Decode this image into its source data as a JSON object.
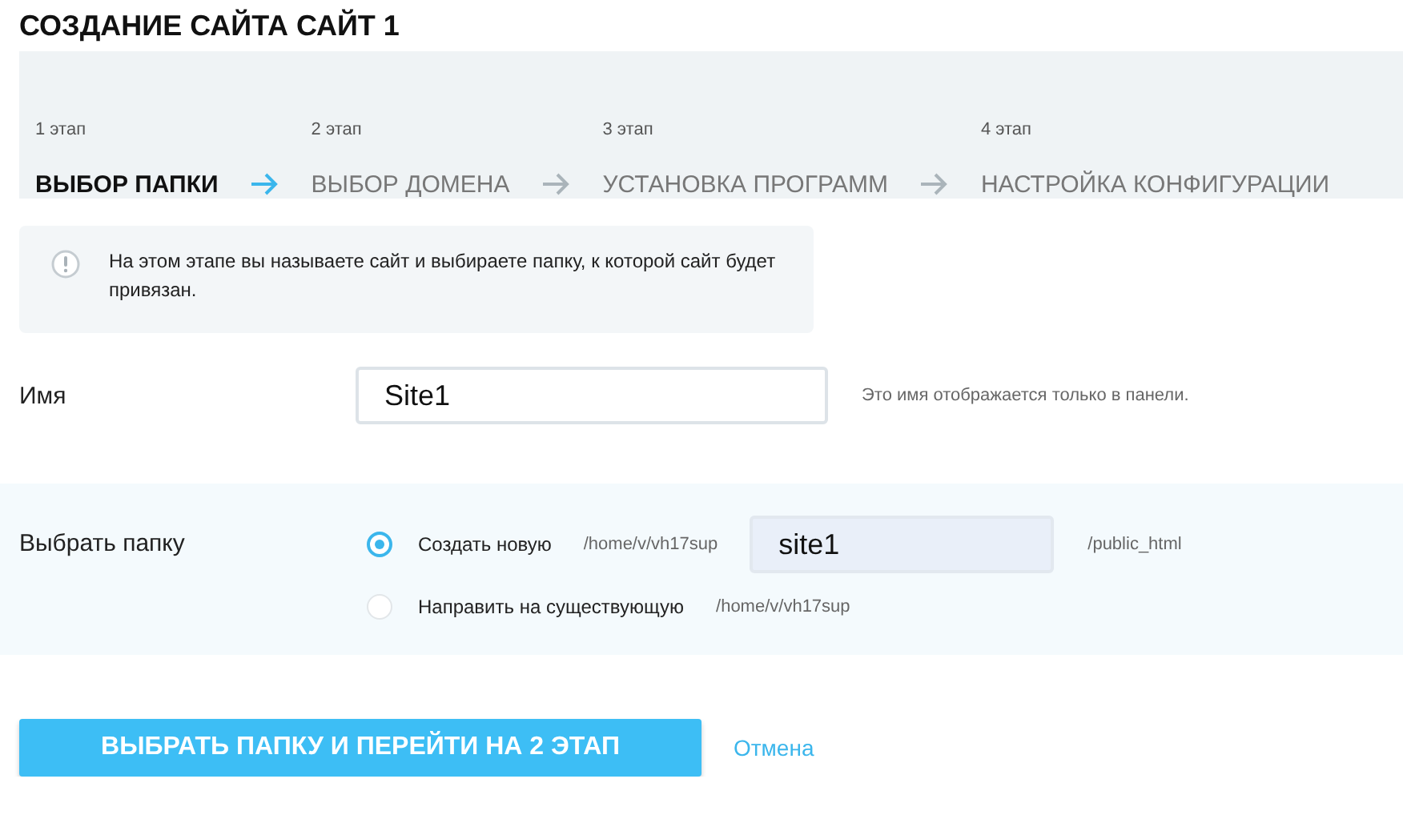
{
  "title": "СОЗДАНИЕ САЙТА САЙТ 1",
  "steps": [
    {
      "number": "1 этап",
      "label": "ВЫБОР ПАПКИ",
      "selected": true
    },
    {
      "number": "2 этап",
      "label": "ВЫБОР ДОМЕНА",
      "selected": false
    },
    {
      "number": "3 этап",
      "label": "УСТАНОВКА ПРОГРАММ",
      "selected": false
    },
    {
      "number": "4 этап",
      "label": "НАСТРОЙКА КОНФИГУРАЦИИ",
      "selected": false
    }
  ],
  "info": {
    "text": "На этом этапе вы называете сайт и выбираете папку, к которой сайт будет привязан."
  },
  "name_field": {
    "label": "Имя",
    "value": "Site1",
    "hint": "Это имя отображается только в панели."
  },
  "folder": {
    "label": "Выбрать папку",
    "options": [
      {
        "label": "Создать новую",
        "selected": true,
        "prefix": "/home/v/vh17sup",
        "value": "site1",
        "suffix": "/public_html"
      },
      {
        "label": "Направить на существующую",
        "selected": false,
        "prefix": "/home/v/vh17sup"
      }
    ]
  },
  "actions": {
    "submit": "ВЫБРАТЬ ПАПКУ И ПЕРЕЙТИ НА 2 ЭТАП",
    "cancel": "Отмена"
  }
}
